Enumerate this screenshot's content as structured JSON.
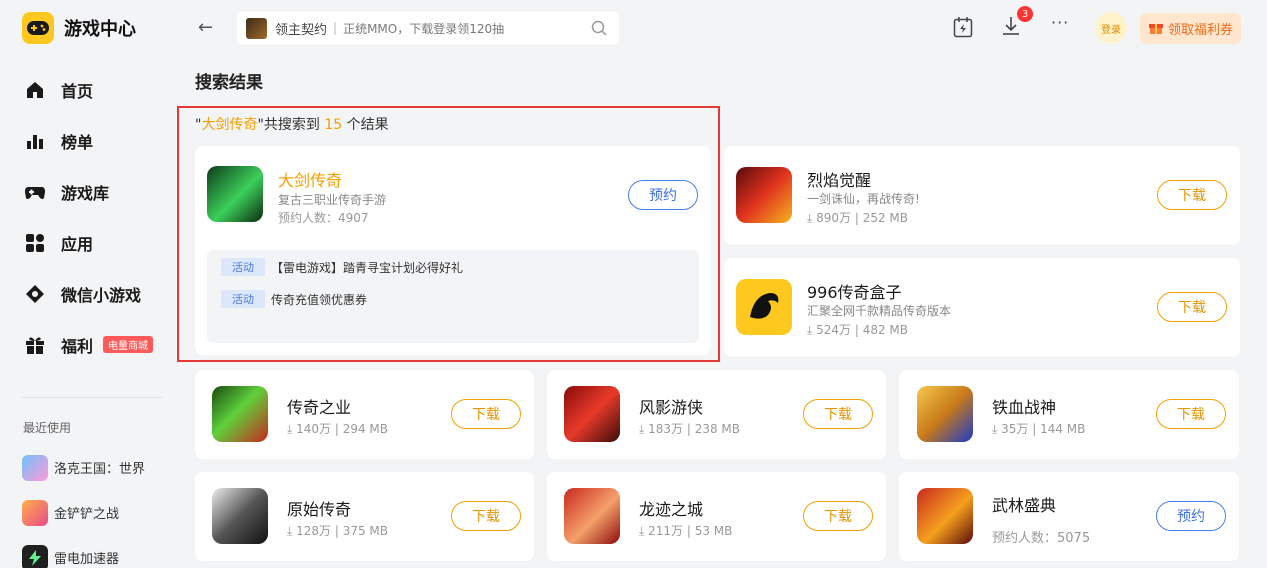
{
  "sidebar": {
    "brand_title": "游戏中心",
    "nav": [
      {
        "label": "首页",
        "icon": "home-icon"
      },
      {
        "label": "榜单",
        "icon": "ranking-icon"
      },
      {
        "label": "游戏库",
        "icon": "gamepad-icon"
      },
      {
        "label": "应用",
        "icon": "apps-icon"
      },
      {
        "label": "微信小游戏",
        "icon": "mini-game-icon"
      },
      {
        "label": "福利",
        "icon": "gift-icon",
        "badge": "电量商城"
      }
    ],
    "recent_title": "最近使用",
    "recent": [
      {
        "label": "洛克王国：世界",
        "color": "#4aa3ff"
      },
      {
        "label": "金铲铲之战",
        "color": "#ff7a4a"
      },
      {
        "label": "雷电加速器",
        "color": "#222222"
      }
    ]
  },
  "header": {
    "search_game": "领主契约",
    "search_sub": "正统MMO，下载登录领120抽",
    "download_badge": "3",
    "login_label": "登录",
    "welfare_label": "领取福利券"
  },
  "page_title": "搜索结果",
  "summary": {
    "open_quote": "\"",
    "keyword": "大剑传奇",
    "mid": "\"共搜索到",
    "count": "15",
    "tail": "个结果"
  },
  "featured": {
    "name": "大剑传奇",
    "desc": "复古三职业传奇手游",
    "meta": "预约人数：4907",
    "button": "预约",
    "activities": [
      {
        "tag": "活动",
        "text": "【雷电游戏】踏青寻宝计划必得好礼"
      },
      {
        "tag": "活动",
        "text": "传奇充值领优惠券"
      }
    ]
  },
  "side_results": [
    {
      "name": "烈焰觉醒",
      "desc": "一剑诛仙，再战传奇!",
      "downloads": "890万",
      "size": "252 MB",
      "button": "下载"
    },
    {
      "name": "996传奇盒子",
      "desc": "汇聚全网千款精品传奇版本",
      "downloads": "524万",
      "size": "482 MB",
      "button": "下载"
    }
  ],
  "grid_results": [
    {
      "name": "传奇之业",
      "downloads": "140万",
      "size": "294 MB",
      "button": "下载"
    },
    {
      "name": "风影游侠",
      "downloads": "183万",
      "size": "238 MB",
      "button": "下载"
    },
    {
      "name": "铁血战神",
      "downloads": "35万",
      "size": "144 MB",
      "button": "下载"
    },
    {
      "name": "原始传奇",
      "downloads": "128万",
      "size": "375 MB",
      "button": "下载"
    },
    {
      "name": "龙迹之城",
      "downloads": "211万",
      "size": "53 MB",
      "button": "下载"
    },
    {
      "name": "武林盛典",
      "meta": "预约人数：5075",
      "button": "预约"
    }
  ],
  "colors": {
    "accent": "#f2a100",
    "reserve": "#3a6fe8",
    "highlight_border": "#e53935"
  }
}
